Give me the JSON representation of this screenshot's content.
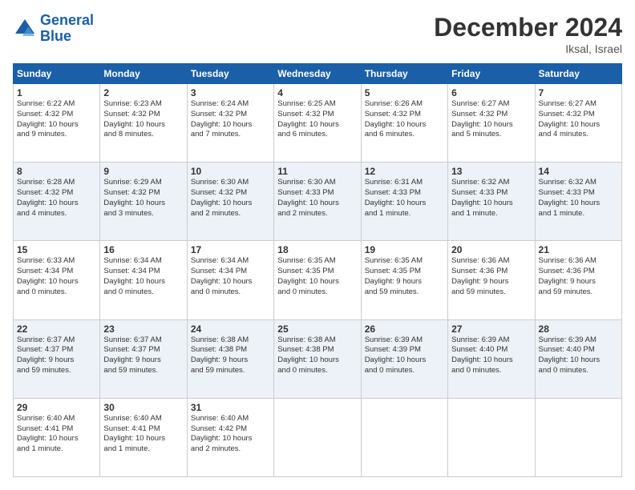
{
  "logo": {
    "line1": "General",
    "line2": "Blue"
  },
  "header": {
    "title": "December 2024",
    "location": "Iksal, Israel"
  },
  "weekdays": [
    "Sunday",
    "Monday",
    "Tuesday",
    "Wednesday",
    "Thursday",
    "Friday",
    "Saturday"
  ],
  "weeks": [
    [
      {
        "day": "1",
        "info": "Sunrise: 6:22 AM\nSunset: 4:32 PM\nDaylight: 10 hours\nand 9 minutes."
      },
      {
        "day": "2",
        "info": "Sunrise: 6:23 AM\nSunset: 4:32 PM\nDaylight: 10 hours\nand 8 minutes."
      },
      {
        "day": "3",
        "info": "Sunrise: 6:24 AM\nSunset: 4:32 PM\nDaylight: 10 hours\nand 7 minutes."
      },
      {
        "day": "4",
        "info": "Sunrise: 6:25 AM\nSunset: 4:32 PM\nDaylight: 10 hours\nand 6 minutes."
      },
      {
        "day": "5",
        "info": "Sunrise: 6:26 AM\nSunset: 4:32 PM\nDaylight: 10 hours\nand 6 minutes."
      },
      {
        "day": "6",
        "info": "Sunrise: 6:27 AM\nSunset: 4:32 PM\nDaylight: 10 hours\nand 5 minutes."
      },
      {
        "day": "7",
        "info": "Sunrise: 6:27 AM\nSunset: 4:32 PM\nDaylight: 10 hours\nand 4 minutes."
      }
    ],
    [
      {
        "day": "8",
        "info": "Sunrise: 6:28 AM\nSunset: 4:32 PM\nDaylight: 10 hours\nand 4 minutes."
      },
      {
        "day": "9",
        "info": "Sunrise: 6:29 AM\nSunset: 4:32 PM\nDaylight: 10 hours\nand 3 minutes."
      },
      {
        "day": "10",
        "info": "Sunrise: 6:30 AM\nSunset: 4:32 PM\nDaylight: 10 hours\nand 2 minutes."
      },
      {
        "day": "11",
        "info": "Sunrise: 6:30 AM\nSunset: 4:33 PM\nDaylight: 10 hours\nand 2 minutes."
      },
      {
        "day": "12",
        "info": "Sunrise: 6:31 AM\nSunset: 4:33 PM\nDaylight: 10 hours\nand 1 minute."
      },
      {
        "day": "13",
        "info": "Sunrise: 6:32 AM\nSunset: 4:33 PM\nDaylight: 10 hours\nand 1 minute."
      },
      {
        "day": "14",
        "info": "Sunrise: 6:32 AM\nSunset: 4:33 PM\nDaylight: 10 hours\nand 1 minute."
      }
    ],
    [
      {
        "day": "15",
        "info": "Sunrise: 6:33 AM\nSunset: 4:34 PM\nDaylight: 10 hours\nand 0 minutes."
      },
      {
        "day": "16",
        "info": "Sunrise: 6:34 AM\nSunset: 4:34 PM\nDaylight: 10 hours\nand 0 minutes."
      },
      {
        "day": "17",
        "info": "Sunrise: 6:34 AM\nSunset: 4:34 PM\nDaylight: 10 hours\nand 0 minutes."
      },
      {
        "day": "18",
        "info": "Sunrise: 6:35 AM\nSunset: 4:35 PM\nDaylight: 10 hours\nand 0 minutes."
      },
      {
        "day": "19",
        "info": "Sunrise: 6:35 AM\nSunset: 4:35 PM\nDaylight: 9 hours\nand 59 minutes."
      },
      {
        "day": "20",
        "info": "Sunrise: 6:36 AM\nSunset: 4:36 PM\nDaylight: 9 hours\nand 59 minutes."
      },
      {
        "day": "21",
        "info": "Sunrise: 6:36 AM\nSunset: 4:36 PM\nDaylight: 9 hours\nand 59 minutes."
      }
    ],
    [
      {
        "day": "22",
        "info": "Sunrise: 6:37 AM\nSunset: 4:37 PM\nDaylight: 9 hours\nand 59 minutes."
      },
      {
        "day": "23",
        "info": "Sunrise: 6:37 AM\nSunset: 4:37 PM\nDaylight: 9 hours\nand 59 minutes."
      },
      {
        "day": "24",
        "info": "Sunrise: 6:38 AM\nSunset: 4:38 PM\nDaylight: 9 hours\nand 59 minutes."
      },
      {
        "day": "25",
        "info": "Sunrise: 6:38 AM\nSunset: 4:38 PM\nDaylight: 10 hours\nand 0 minutes."
      },
      {
        "day": "26",
        "info": "Sunrise: 6:39 AM\nSunset: 4:39 PM\nDaylight: 10 hours\nand 0 minutes."
      },
      {
        "day": "27",
        "info": "Sunrise: 6:39 AM\nSunset: 4:40 PM\nDaylight: 10 hours\nand 0 minutes."
      },
      {
        "day": "28",
        "info": "Sunrise: 6:39 AM\nSunset: 4:40 PM\nDaylight: 10 hours\nand 0 minutes."
      }
    ],
    [
      {
        "day": "29",
        "info": "Sunrise: 6:40 AM\nSunset: 4:41 PM\nDaylight: 10 hours\nand 1 minute."
      },
      {
        "day": "30",
        "info": "Sunrise: 6:40 AM\nSunset: 4:41 PM\nDaylight: 10 hours\nand 1 minute."
      },
      {
        "day": "31",
        "info": "Sunrise: 6:40 AM\nSunset: 4:42 PM\nDaylight: 10 hours\nand 2 minutes."
      },
      null,
      null,
      null,
      null
    ]
  ]
}
